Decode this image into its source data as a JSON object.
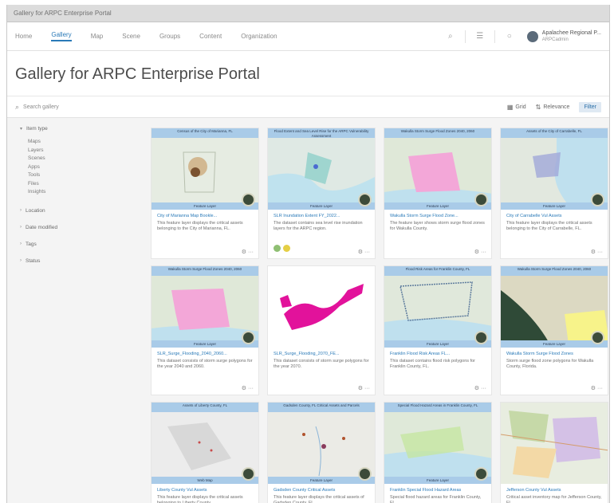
{
  "browser": {
    "tab_title": "Gallery for ARPC Enterprise Portal"
  },
  "nav": {
    "items": [
      "Home",
      "Gallery",
      "Map",
      "Scene",
      "Groups",
      "Content",
      "Organization"
    ],
    "active_index": 1,
    "user_name": "Apalachee Regional P...",
    "user_sub": "ARPCadmin"
  },
  "page": {
    "title": "Gallery for ARPC Enterprise Portal"
  },
  "search": {
    "placeholder": "Search gallery",
    "grid_label": "Grid",
    "sort_label": "Relevance",
    "filter_label": "Filter"
  },
  "sidebar": {
    "item_type_label": "Item type",
    "item_types": [
      "Maps",
      "Layers",
      "Scenes",
      "Apps",
      "Tools",
      "Files",
      "Insights"
    ],
    "groups": [
      "Location",
      "Date modified",
      "Tags",
      "Status"
    ]
  },
  "colors": {
    "accent": "#2a7ab8",
    "banner": "#a9cbe8",
    "surge_pink": "#f3a7d8",
    "magenta": "#e2129b"
  },
  "cards": [
    {
      "banner": "Census of the City of Marianna, FL",
      "footer_banner": "Feature Layer",
      "title": "City of Marianna Map Bookle...",
      "desc": "This feature layer displays the critical assets belonging to the City of Marianna, FL."
    },
    {
      "banner": "Flood Extent and Sea Level Rise for the ARPC Vulnerability Assessment",
      "footer_banner": "Feature Layer",
      "title": "SLR Inundation Extent FY_2022...",
      "desc": "The dataset contains sea level rise inundation layers for the ARPC region."
    },
    {
      "banner": "Wakulla Storm Surge Flood Zones 2040, 2060",
      "footer_banner": "Feature Layer",
      "title": "Wakulla Storm Surge Flood Zone...",
      "desc": "The feature layer shows storm surge flood zones for Wakulla County."
    },
    {
      "banner": "Assets of the City of Carrabelle, FL",
      "footer_banner": "Feature Layer",
      "title": "City of Carrabelle Vul Assets",
      "desc": "This feature layer displays the critical assets belonging to the City of Carrabelle, FL."
    },
    {
      "banner": "Wakulla Storm Surge Flood Zones 2040, 2060",
      "footer_banner": "Feature Layer",
      "title": "SLR_Surge_Flooding_2040_2060...",
      "desc": "This dataset consists of storm surge polygons for the year 2040 and 2060."
    },
    {
      "banner": "",
      "footer_banner": "",
      "title": "SLR_Surge_Flooding_2070_FE...",
      "desc": "This dataset consists of storm surge polygons for the year 2070."
    },
    {
      "banner": "Flood Risk Areas for Franklin County, FL",
      "footer_banner": "Feature Layer",
      "title": "Franklin Flood Risk Areas FL...",
      "desc": "This dataset contains flood risk polygons for Franklin County, FL."
    },
    {
      "banner": "Wakulla Storm Surge Flood Zones 2040, 2060",
      "footer_banner": "Feature Layer",
      "title": "Wakulla Storm Surge Flood Zones",
      "desc": "Storm surge flood zone polygons for Wakulla County, Florida."
    },
    {
      "banner": "Assets of Liberty County, FL",
      "footer_banner": "Web Map",
      "title": "Liberty County Vul Assets",
      "desc": "This feature layer displays the critical assets belonging to Liberty County."
    },
    {
      "banner": "Gadsden County, FL Critical Assets and Parcels",
      "footer_banner": "Feature Layer",
      "title": "Gadsden County Critical Assets",
      "desc": "This feature layer displays the critical assets of Gadsden County, FL."
    },
    {
      "banner": "Special Flood Hazard Areas in Franklin County, FL",
      "footer_banner": "Feature Layer",
      "title": "Franklin Special Flood Hazard Areas",
      "desc": "Special flood hazard areas for Franklin County, FL."
    },
    {
      "banner": "",
      "footer_banner": "",
      "title": "Jefferson County Vul Assets",
      "desc": "Critical asset inventory map for Jefferson County, FL."
    }
  ]
}
